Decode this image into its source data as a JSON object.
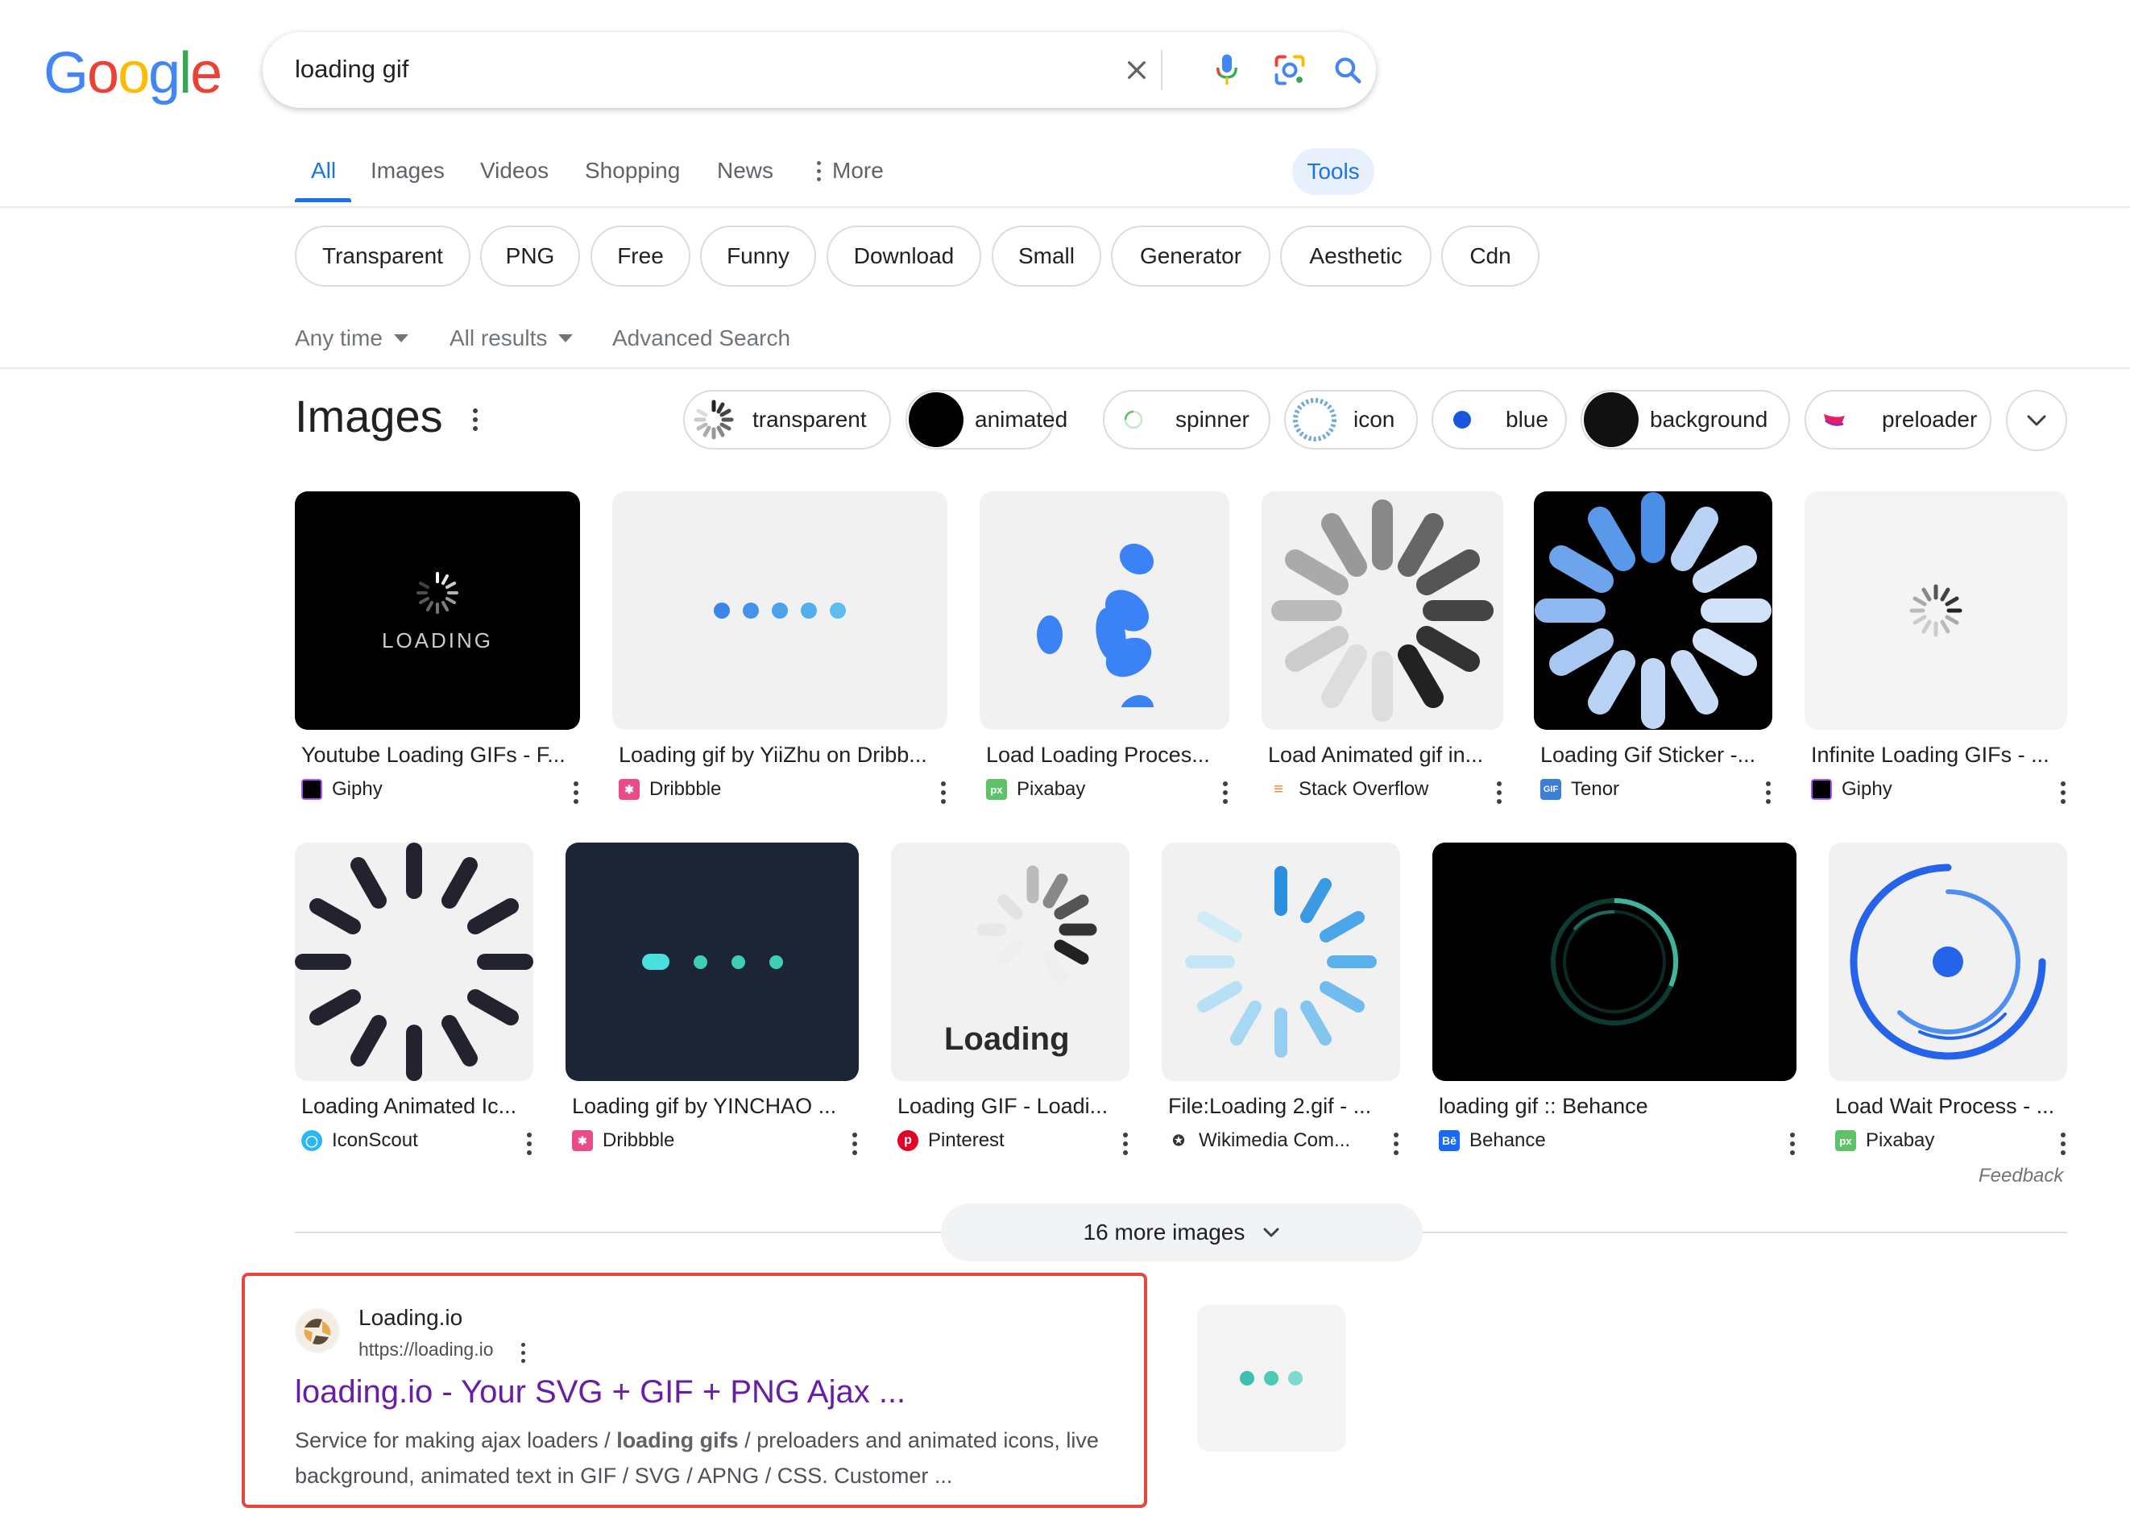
{
  "logo": {
    "text": "Google",
    "letters": [
      "G",
      "o",
      "o",
      "g",
      "l",
      "e"
    ],
    "colors": [
      "#4285f4",
      "#ea4335",
      "#fbbc05",
      "#4285f4",
      "#34a853",
      "#ea4335"
    ]
  },
  "search": {
    "query": "loading gif",
    "clear_icon": "close-icon",
    "voice_icon": "mic-icon",
    "lens_icon": "lens-icon",
    "search_icon": "search-icon"
  },
  "tabs": [
    {
      "label": "All",
      "active": true
    },
    {
      "label": "Images"
    },
    {
      "label": "Videos"
    },
    {
      "label": "Shopping"
    },
    {
      "label": "News"
    },
    {
      "label": "More"
    }
  ],
  "tools_label": "Tools",
  "suggestion_chips": [
    "Transparent",
    "PNG",
    "Free",
    "Funny",
    "Download",
    "Small",
    "Generator",
    "Aesthetic",
    "Cdn"
  ],
  "filters": {
    "time": "Any time",
    "results": "All results",
    "advanced": "Advanced Search"
  },
  "images_section": {
    "heading": "Images",
    "refine_chips": [
      "transparent",
      "animated",
      "spinner",
      "icon",
      "blue",
      "background",
      "preloader"
    ],
    "row1": [
      {
        "title": "Youtube Loading GIFs - F...",
        "source": "Giphy",
        "thumb_text": "LOADING"
      },
      {
        "title": "Loading gif by YiiZhu on Dribb...",
        "source": "Dribbble"
      },
      {
        "title": "Load Loading Proces...",
        "source": "Pixabay"
      },
      {
        "title": "Load Animated gif in...",
        "source": "Stack Overflow"
      },
      {
        "title": "Loading Gif Sticker -...",
        "source": "Tenor"
      },
      {
        "title": "Infinite Loading GIFs - ...",
        "source": "Giphy"
      }
    ],
    "row2": [
      {
        "title": "Loading Animated Ic...",
        "source": "IconScout"
      },
      {
        "title": "Loading gif by YINCHAO ...",
        "source": "Dribbble"
      },
      {
        "title": "Loading GIF - Loadi...",
        "source": "Pinterest",
        "thumb_text": "Loading"
      },
      {
        "title": "File:Loading 2.gif - ...",
        "source": "Wikimedia Com..."
      },
      {
        "title": "loading gif :: Behance",
        "source": "Behance"
      },
      {
        "title": "Load Wait Process - ...",
        "source": "Pixabay"
      }
    ],
    "feedback": "Feedback",
    "more_label": "16 more images"
  },
  "result": {
    "site_name": "Loading.io",
    "url": "https://loading.io",
    "title": "loading.io - Your SVG + GIF + PNG Ajax ...",
    "snippet_pre": "Service for making ajax loaders / ",
    "snippet_bold": "loading gifs",
    "snippet_post": " / preloaders and animated icons, live background, animated text in GIF / SVG / APNG / CSS. Customer ..."
  }
}
